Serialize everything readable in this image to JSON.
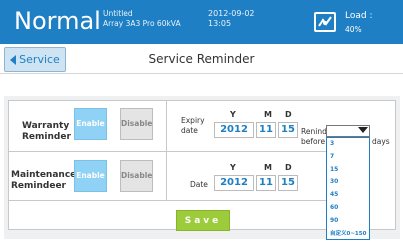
{
  "header": {
    "mode": "Normal",
    "doc_name": "Untitled",
    "device": "Array 3A3 Pro 60kVA",
    "date": "2012-09-02",
    "time": "13:05",
    "load_label": "Load :",
    "load_value": "40%",
    "color": "#1e7fc4"
  },
  "nav": {
    "back_label": "Service",
    "title": "Service Reminder"
  },
  "warranty": {
    "label_line1": "Warranty",
    "label_line2": "Reminder",
    "enable": "Enable",
    "disable": "Disable",
    "selected": "Enable",
    "expiry_line1": "Expiry",
    "expiry_line2": "date",
    "year_head": "Y",
    "month_head": "M",
    "day_head": "D",
    "year": "2012",
    "month": "11",
    "day": "15",
    "remind_line1": "Renind",
    "remind_line2": "before",
    "days": "days"
  },
  "maintenance": {
    "label_line1": "Maintenance",
    "label_line2": "Remindeer",
    "enable": "Enable",
    "disable": "Disable",
    "selected": "Enable",
    "date_label": "Date",
    "year_head": "Y",
    "month_head": "M",
    "day_head": "D",
    "year": "2012",
    "month": "11",
    "day": "15"
  },
  "dropdown": {
    "options": [
      "3",
      "7",
      "15",
      "30",
      "45",
      "60",
      "90",
      "自定义0~150"
    ]
  },
  "save_label": "Save",
  "colors": {
    "accent": "#1e7fc4",
    "enable_on": "#8fd2f5",
    "save": "#9ccc3c"
  }
}
